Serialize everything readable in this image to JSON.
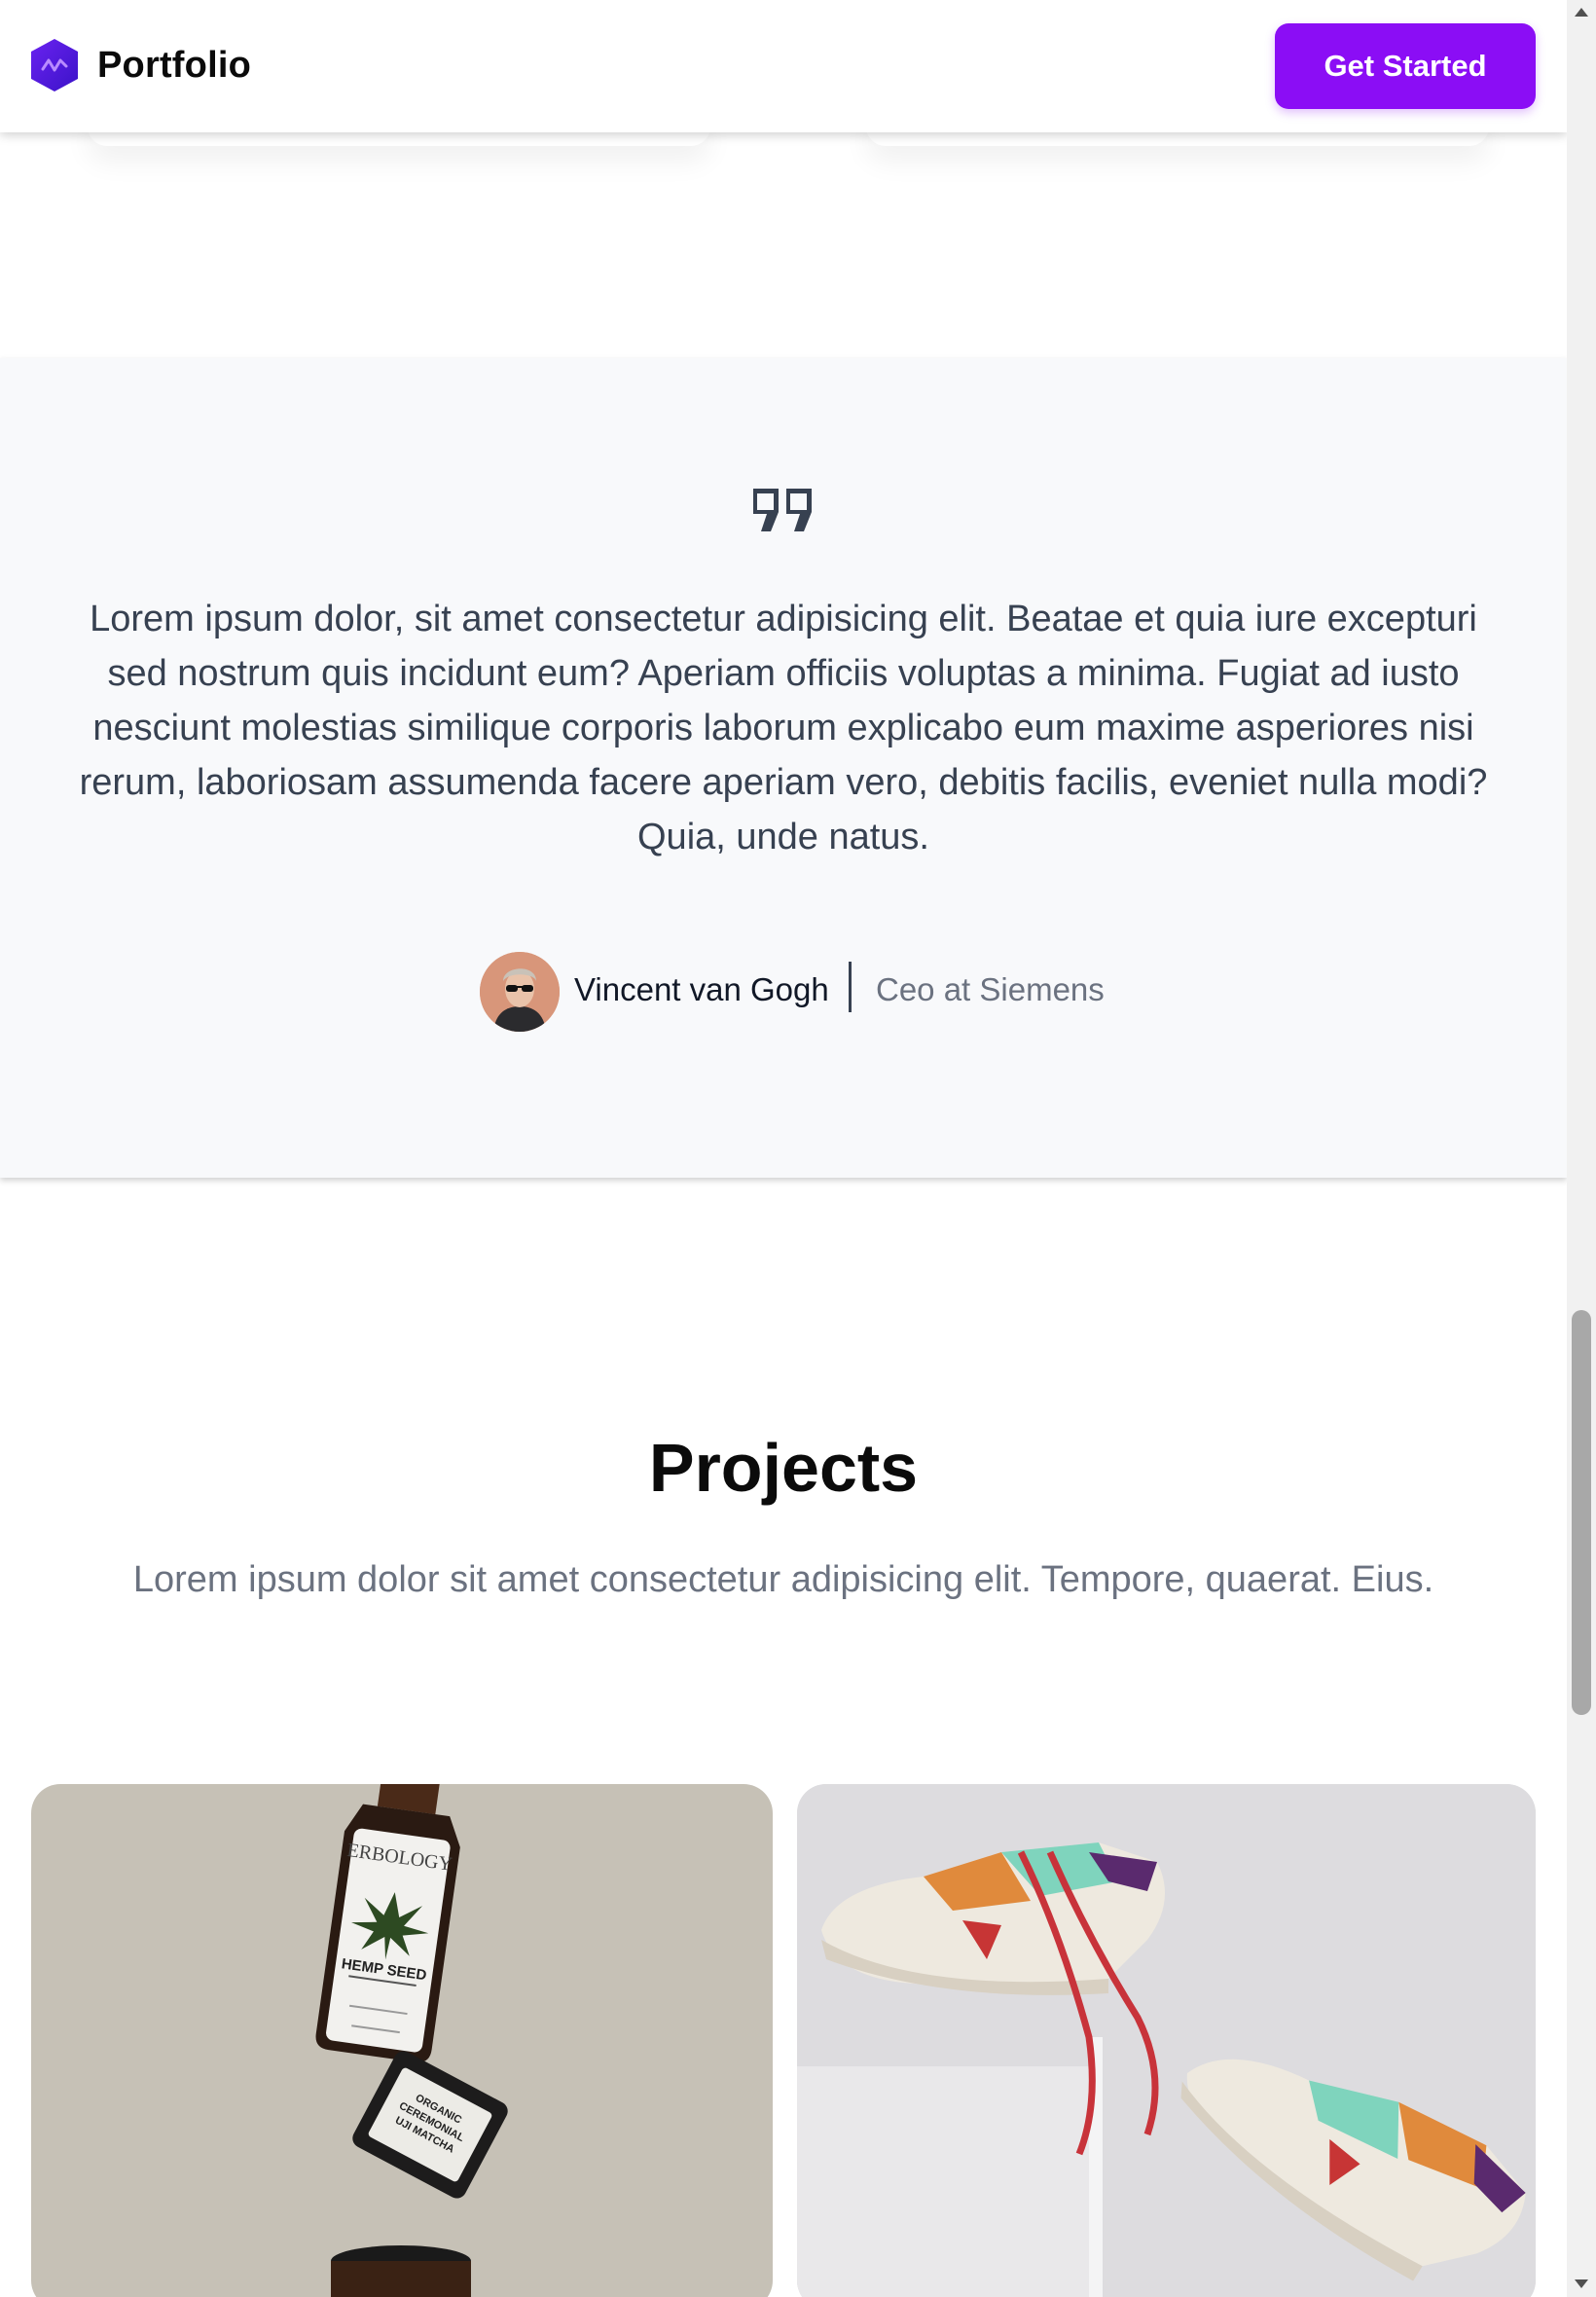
{
  "header": {
    "logo_text": "Portfolio",
    "cta_label": "Get Started",
    "accent_color": "#8b0df5"
  },
  "testimonial": {
    "quote_icon": "quote-icon",
    "quote": "Lorem ipsum dolor, sit amet consectetur adipisicing elit. Beatae et quia iure excepturi sed nostrum quis incidunt eum? Aperiam officiis voluptas a minima. Fugiat ad iusto nesciunt molestias similique corporis laborum explicabo eum maxime asperiores nisi rerum, laboriosam assumenda facere aperiam vero, debitis facilis, eveniet nulla modi? Quia, unde natus.",
    "author_name": "Vincent van Gogh",
    "author_role": "Ceo at Siemens"
  },
  "projects": {
    "title": "Projects",
    "subtitle": "Lorem ipsum dolor sit amet consectetur adipisicing elit. Tempore, quaerat. Eius.",
    "items": [
      {
        "image_label": "ERBOLOGY",
        "product": "HEMP SEED",
        "jar_label": "ORGANIC CEREMONIAL UJI MATCHA"
      },
      {
        "image": "sneakers-photo"
      }
    ]
  }
}
